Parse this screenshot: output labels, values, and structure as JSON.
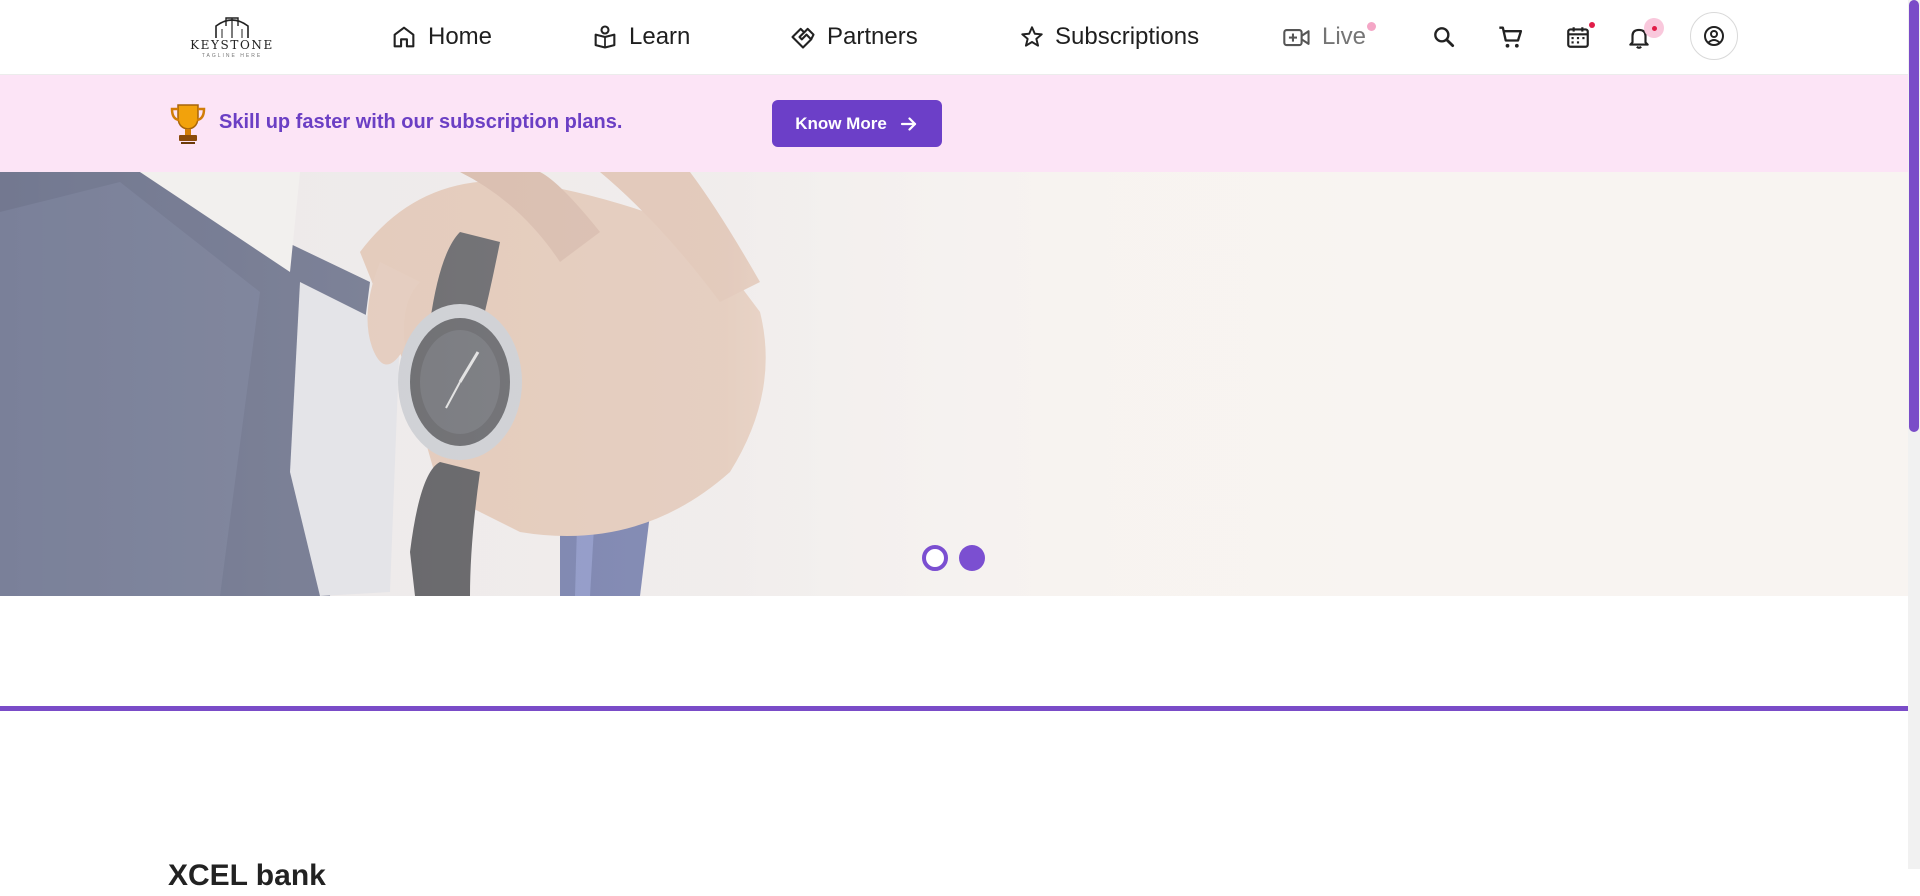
{
  "brand": {
    "name": "KEYSTONE",
    "tagline": "TAGLINE HERE"
  },
  "nav": {
    "home": "Home",
    "learn": "Learn",
    "partners": "Partners",
    "subscriptions": "Subscriptions",
    "live": "Live"
  },
  "icons": {
    "home": "home-icon",
    "learn": "learn-icon",
    "partners": "handshake-icon",
    "subscriptions": "star-icon",
    "live": "video-plus-icon",
    "search": "search-icon",
    "cart": "cart-icon",
    "calendar": "calendar-icon",
    "notifications": "bell-icon",
    "profile": "profile-icon",
    "trophy": "trophy-icon",
    "arrow": "arrow-right-icon"
  },
  "promo": {
    "message": "Skill up faster with our subscription plans.",
    "button_label": "Know More"
  },
  "carousel": {
    "slides_total": 2,
    "active_slide": 2
  },
  "section": {
    "heading": "XCEL bank"
  },
  "colors": {
    "accent": "#6c3fc8",
    "promo_bg": "#fce4f6",
    "promo_text": "#6b3fc4",
    "notification": "#e11d48",
    "live_indicator": "#f4a6c6"
  }
}
